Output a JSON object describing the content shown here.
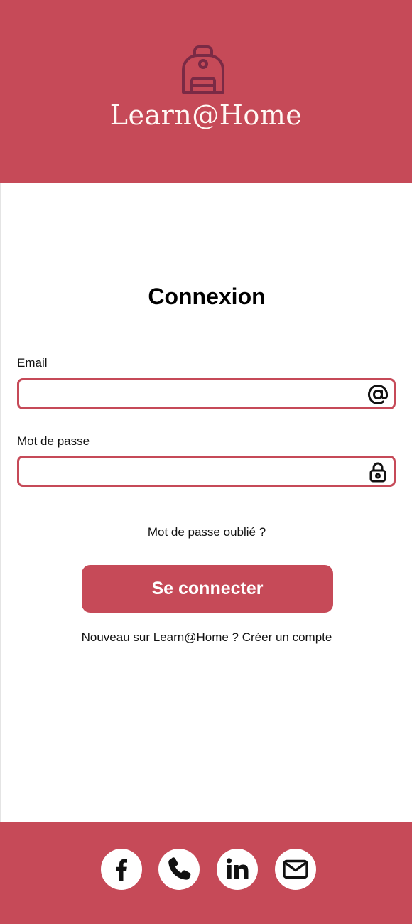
{
  "header": {
    "brand": "Learn@Home",
    "logo_icon": "backpack-icon",
    "background": "#c64a58",
    "logo_color": "#7a2a45"
  },
  "login": {
    "title": "Connexion",
    "email_label": "Email",
    "email_value": "",
    "email_icon": "at-sign-icon",
    "password_label": "Mot de passe",
    "password_value": "",
    "password_icon": "lock-icon",
    "forgot_link": "Mot de passe oublié ?",
    "submit_label": "Se connecter",
    "signup_prompt": "Nouveau sur Learn@Home ?",
    "signup_link": "Créer un compte",
    "accent": "#c64a58"
  },
  "footer": {
    "background": "#c64a58",
    "icons": [
      "facebook-icon",
      "phone-icon",
      "linkedin-icon",
      "mail-icon"
    ]
  }
}
